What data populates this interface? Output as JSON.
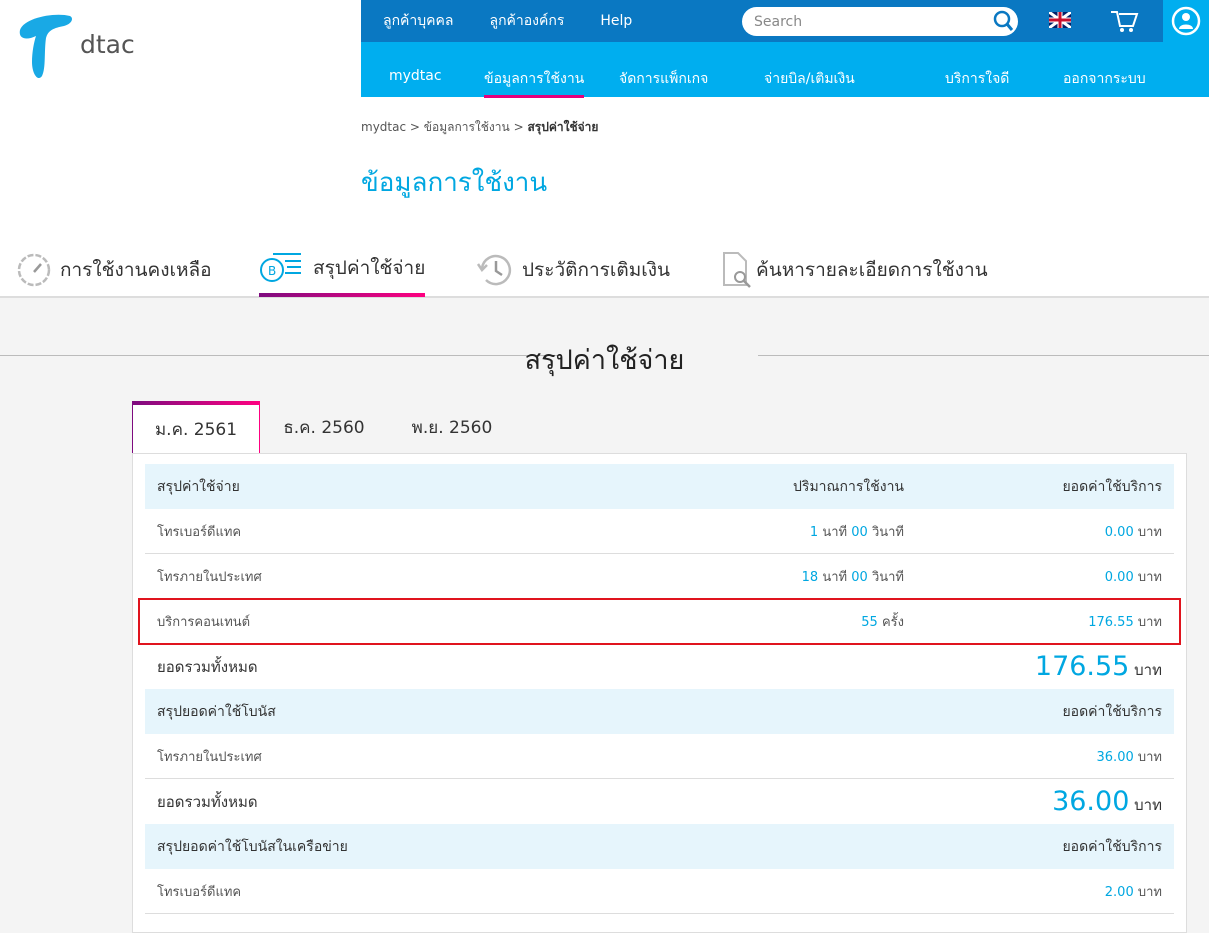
{
  "brand": {
    "logo_text": "dtac"
  },
  "topbar": {
    "links": [
      "ลูกค้าบุคคล",
      "ลูกค้าองค์กร",
      "Help"
    ],
    "search_placeholder": "Search"
  },
  "nav": {
    "items": [
      "mydtac",
      "ข้อมูลการใช้งาน",
      "จัดการแพ็กเกจ",
      "จ่ายบิล/เติมเงิน",
      "บริการใจดี",
      "ออกจากระบบ"
    ],
    "active": 1
  },
  "breadcrumb": {
    "items": [
      "mydtac",
      "ข้อมูลการใช้งาน"
    ],
    "current": "สรุปค่าใช้จ่าย",
    "sep": ">"
  },
  "page_title": "ข้อมูลการใช้งาน",
  "sub_tabs": [
    "การใช้งานคงเหลือ",
    "สรุปค่าใช้จ่าย",
    "ประวัติการเติมเงิน",
    "ค้นหารายละเอียดการใช้งาน"
  ],
  "section_title": "สรุปค่าใช้จ่าย",
  "month_tabs": [
    "ม.ค. 2561",
    "ธ.ค. 2560",
    "พ.ย. 2560"
  ],
  "units": {
    "baht": "บาท",
    "min": "นาที",
    "sec": "วินาที",
    "times": "ครั้ง"
  },
  "summary": {
    "header": [
      "สรุปค่าใช้จ่าย",
      "ปริมาณการใช้งาน",
      "ยอดค่าใช้บริการ"
    ],
    "rows": [
      {
        "label": "โทรเบอร์ดีแทค",
        "min": "1",
        "sec": "00",
        "amount": "0.00"
      },
      {
        "label": "โทรภายในประเทศ",
        "min": "18",
        "sec": "00",
        "amount": "0.00"
      },
      {
        "label": "บริการคอนเทนต์",
        "count": "55",
        "amount": "176.55"
      }
    ],
    "total_label": "ยอดรวมทั้งหมด",
    "total": "176.55"
  },
  "bonus": {
    "header": [
      "สรุปยอดค่าใช้โบนัส",
      "ยอดค่าใช้บริการ"
    ],
    "rows": [
      {
        "label": "โทรภายในประเทศ",
        "amount": "36.00"
      }
    ],
    "total_label": "ยอดรวมทั้งหมด",
    "total": "36.00"
  },
  "bonus_net": {
    "header": [
      "สรุปยอดค่าใช้โบนัสในเครือข่าย",
      "ยอดค่าใช้บริการ"
    ],
    "rows": [
      {
        "label": "โทรเบอร์ดีแทค",
        "amount": "2.00"
      }
    ]
  }
}
